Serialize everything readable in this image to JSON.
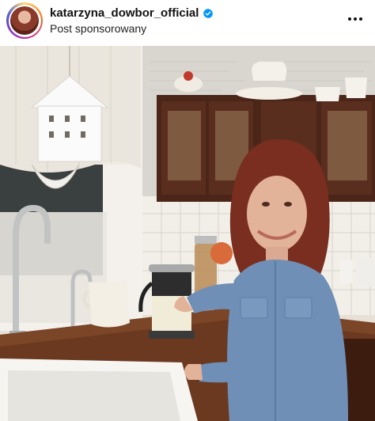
{
  "post": {
    "username": "katarzyna_dowbor_official",
    "subtitle": "Post sponsorowany",
    "verified": true,
    "icons": {
      "verified": "verified-badge-icon",
      "more": "more-options-icon"
    },
    "colors": {
      "verified_blue": "#0095f6",
      "story_ring": [
        "#feda75",
        "#fa7e1e",
        "#d62976",
        "#962fbf",
        "#4f5bd5"
      ]
    }
  }
}
